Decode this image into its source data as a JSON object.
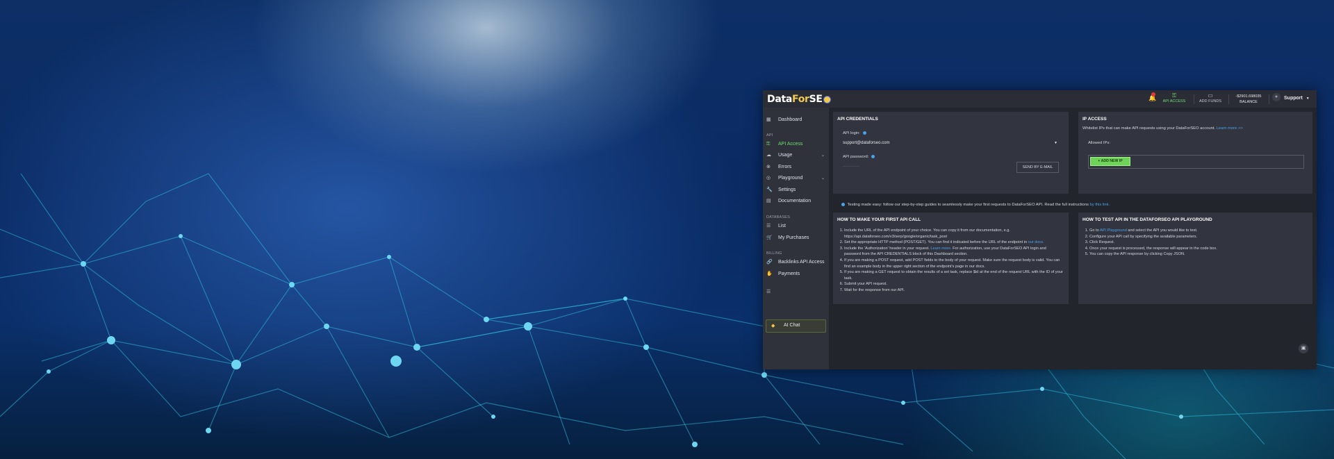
{
  "header": {
    "logo_data": "Data",
    "logo_for": "For",
    "logo_seo": "SE",
    "api_access": "API ACCESS",
    "add_funds": "ADD FUNDS",
    "balance_value": "-$2901.698035",
    "balance_label": "BALANCE",
    "support": "Support"
  },
  "sidebar": {
    "dashboard": "Dashboard",
    "section_api": "API",
    "api_access": "API Access",
    "usage": "Usage",
    "errors": "Errors",
    "playground": "Playground",
    "settings": "Settings",
    "documentation": "Documentation",
    "section_databases": "DATABASES",
    "list": "List",
    "my_purchases": "My Purchases",
    "section_billing": "BILLING",
    "backlinks": "Backlinks API Access",
    "payments": "Payments",
    "ai_chat": "AI Chat"
  },
  "credentials": {
    "title": "API CREDENTIALS",
    "login_label": "API login:",
    "login_value": "support@dataforseo.com",
    "password_label": "API password:",
    "password_value": "············",
    "send_button": "SEND BY E-MAIL"
  },
  "ip_access": {
    "title": "IP ACCESS",
    "desc": "Whitelist IPs that can make API requests using your DataForSEO account.",
    "learn_more": "Learn more >>",
    "allowed_label": "Allowed IPs:",
    "add_button": "+ ADD NEW IP"
  },
  "note": {
    "text": "Testing made easy: follow our step-by-step guides to seamlessly make your first requests to DataForSEO API. Read the full instructions",
    "link": "by this link."
  },
  "first_call": {
    "title": "HOW TO MAKE YOUR FIRST API CALL",
    "steps": [
      "Include the URL of the API endpoint of your choice. You can copy it from our documentation, e.g. https://api.dataforseo.com/v3/serp/google/organic/task_post",
      "Set the appropriate HTTP method (POST/GET). You can find it indicated before the URL of the endpoint in",
      "Include the 'Authorization' header in your request.",
      "If you are making a POST request, add POST fields to the body of your request. Make sure the request body is valid. You can find an example body in the upper right section of the endpoint's page in our docs.",
      "If you are making a GET request to obtain the results of a set task, replace $id at the end of the request URL with the ID of your task.",
      "Submit your API request.",
      "Wait for the response from our API."
    ],
    "step2_link": "our docs.",
    "step3_link": "Learn more.",
    "step3_rest": "For authorization, use your DataForSEO API login and password from the API CREDENTIALS block of this Dashboard section."
  },
  "playground_card": {
    "title": "HOW TO TEST API IN THE DATAFORSEO API PLAYGROUND",
    "step1_pre": "Go to",
    "step1_link": "API Playground",
    "step1_post": "and select the API you would like to test.",
    "step2": "Configure your API call by specifying the available parameters.",
    "step3": "Click Request.",
    "step4": "Once your request is processed, the response will appear in the code box.",
    "step5": "You can copy the API response by clicking Copy JSON."
  },
  "colors": {
    "accent_green": "#6fe06f",
    "link_blue": "#4aa3e8",
    "logo_yellow": "#f2c94c",
    "panel_bg": "#23252d",
    "card_bg": "#32343f"
  }
}
